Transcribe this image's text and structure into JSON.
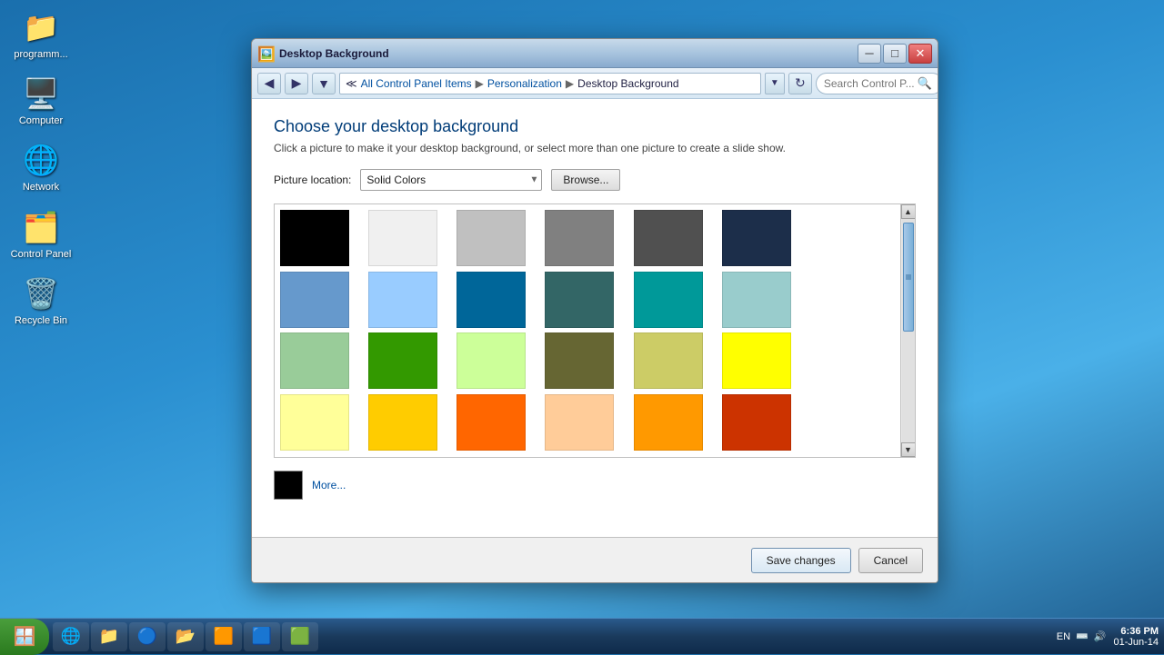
{
  "desktop": {
    "background_style": "blue gradient"
  },
  "desktop_icons": [
    {
      "id": "programm",
      "label": "programm...",
      "icon": "📁"
    },
    {
      "id": "computer",
      "label": "Computer",
      "icon": "🖥️"
    },
    {
      "id": "network",
      "label": "Network",
      "icon": "🌐"
    },
    {
      "id": "control-panel",
      "label": "Control Panel",
      "icon": "🗂️"
    },
    {
      "id": "recycle-bin",
      "label": "Recycle Bin",
      "icon": "🗑️"
    }
  ],
  "taskbar": {
    "start_label": "Start",
    "clock_time": "6:36 PM",
    "clock_date": "01-Jun-14",
    "locale": "EN",
    "items": [
      {
        "id": "start",
        "icon": "🪟"
      },
      {
        "id": "ie",
        "icon": "🌐"
      },
      {
        "id": "folder",
        "icon": "📁"
      },
      {
        "id": "chrome",
        "icon": "🔵"
      },
      {
        "id": "files",
        "icon": "📂"
      },
      {
        "id": "program1",
        "icon": "🟧"
      },
      {
        "id": "program2",
        "icon": "🟦"
      },
      {
        "id": "program3",
        "icon": "🟩"
      }
    ]
  },
  "window": {
    "title": "Desktop Background",
    "breadcrumb": {
      "items": [
        "All Control Panel Items",
        "Personalization",
        "Desktop Background"
      ]
    },
    "search_placeholder": "Search Control P...",
    "page_title": "Choose your desktop background",
    "page_subtitle": "Click a picture to make it your desktop background, or select more than one picture to create a slide show.",
    "location_label": "Picture location:",
    "location_value": "Solid Colors",
    "browse_label": "Browse...",
    "more_label": "More...",
    "colors": [
      "#000000",
      "#ffffff",
      "#c0c0c0",
      "#808080",
      "#404040",
      "#1c2e4a",
      "#6699cc",
      "#99ccff",
      "#006699",
      "#336666",
      "#009999",
      "#99cccc",
      "#99cc99",
      "#339900",
      "#ccff99",
      "#666633",
      "#cccc66",
      "#ffff00",
      "#ffff99",
      "#ffcc00",
      "#ff6600",
      "#ffcc99",
      "#ff9900",
      "#cc3300"
    ],
    "more_color": "#000000",
    "footer": {
      "save_label": "Save changes",
      "cancel_label": "Cancel"
    }
  }
}
